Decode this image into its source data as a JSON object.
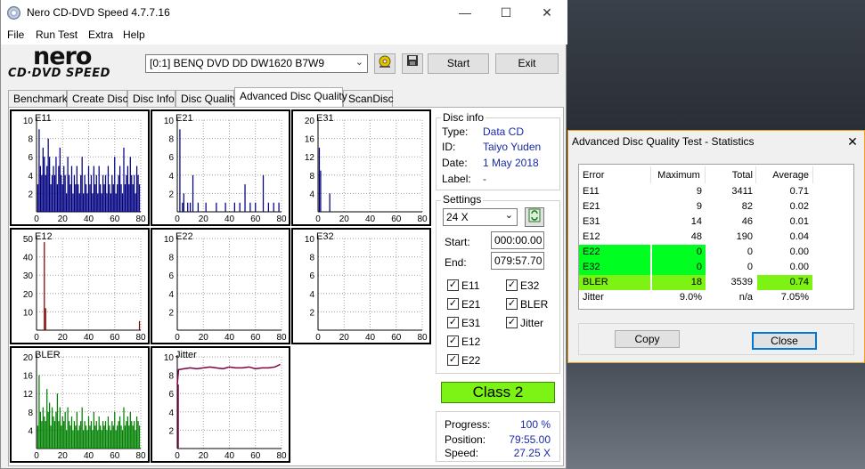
{
  "window": {
    "title": "Nero CD-DVD Speed 4.7.7.16",
    "minimize_glyph": "—",
    "maximize_glyph": "☐",
    "close_glyph": "✕"
  },
  "menu": [
    "File",
    "Run Test",
    "Extra",
    "Help"
  ],
  "logo": {
    "line1": "nero",
    "line2": "CD·DVD SPEED"
  },
  "toolbar": {
    "drive": "[0:1]   BENQ DVD DD DW1620 B7W9",
    "start": "Start",
    "exit": "Exit",
    "icons": [
      "eject-icon",
      "save-icon"
    ]
  },
  "tabs": [
    "Benchmark",
    "Create Disc",
    "Disc Info",
    "Disc Quality",
    "Advanced Disc Quality",
    "ScanDisc"
  ],
  "active_tab": "Advanced Disc Quality",
  "chart_data": [
    {
      "type": "bar",
      "title": "E11",
      "ylim": [
        0,
        10
      ],
      "yticks": [
        2,
        4,
        6,
        8,
        10
      ],
      "xticks": [
        0,
        20,
        40,
        60,
        80
      ],
      "color": "#000080",
      "x": [
        1,
        2,
        3,
        4,
        5,
        6,
        7,
        8,
        9,
        10,
        11,
        12,
        13,
        14,
        15,
        16,
        17,
        18,
        19,
        20,
        21,
        22,
        23,
        24,
        25,
        26,
        27,
        28,
        29,
        30,
        31,
        32,
        33,
        34,
        35,
        36,
        37,
        38,
        39,
        40,
        41,
        42,
        43,
        44,
        45,
        46,
        47,
        48,
        49,
        50,
        51,
        52,
        53,
        54,
        55,
        56,
        57,
        58,
        59,
        60,
        61,
        62,
        63,
        64,
        65,
        66,
        67,
        68,
        69,
        70,
        71,
        72,
        73,
        74,
        75,
        76,
        77,
        78,
        79
      ],
      "values": [
        3,
        9,
        5,
        4,
        7,
        6,
        4,
        5,
        8,
        6,
        3,
        4,
        5,
        4,
        6,
        3,
        5,
        7,
        4,
        3,
        5,
        4,
        2,
        6,
        4,
        3,
        5,
        2,
        4,
        3,
        5,
        3,
        2,
        4,
        6,
        2,
        4,
        3,
        2,
        5,
        3,
        4,
        2,
        5,
        3,
        4,
        2,
        5,
        3,
        2,
        4,
        3,
        4,
        2,
        5,
        3,
        2,
        4,
        3,
        6,
        2,
        3,
        4,
        5,
        3,
        2,
        7,
        3,
        4,
        5,
        3,
        6,
        4,
        3,
        4,
        2,
        5,
        4,
        3
      ]
    },
    {
      "type": "bar",
      "title": "E21",
      "ylim": [
        0,
        10
      ],
      "yticks": [
        2,
        4,
        6,
        8,
        10
      ],
      "xticks": [
        0,
        20,
        40,
        60,
        80
      ],
      "color": "#000080",
      "x": [
        2,
        4,
        5,
        8,
        10,
        12,
        16,
        22,
        30,
        37,
        44,
        48,
        52,
        56,
        60,
        66,
        70,
        74,
        78
      ],
      "values": [
        9,
        1,
        2,
        1,
        1,
        4,
        1,
        1,
        1,
        1,
        1,
        1,
        3,
        1,
        1,
        4,
        1,
        1,
        1
      ]
    },
    {
      "type": "bar",
      "title": "E31",
      "ylim": [
        0,
        20
      ],
      "yticks": [
        4,
        8,
        12,
        16,
        20
      ],
      "xticks": [
        0,
        20,
        40,
        60,
        80
      ],
      "color": "#000080",
      "x": [
        1,
        2,
        9
      ],
      "values": [
        14,
        9,
        4
      ]
    },
    {
      "type": "bar",
      "title": "E12",
      "ylim": [
        0,
        50
      ],
      "yticks": [
        10,
        20,
        30,
        40,
        50
      ],
      "xticks": [
        0,
        20,
        40,
        60,
        80
      ],
      "color": "#800000",
      "x": [
        6,
        7,
        79
      ],
      "values": [
        48,
        12,
        5
      ]
    },
    {
      "type": "bar",
      "title": "E22",
      "ylim": [
        0,
        10
      ],
      "yticks": [
        2,
        4,
        6,
        8,
        10
      ],
      "xticks": [
        0,
        20,
        40,
        60,
        80
      ],
      "color": "#000080",
      "x": [],
      "values": []
    },
    {
      "type": "bar",
      "title": "E32",
      "ylim": [
        0,
        10
      ],
      "yticks": [
        2,
        4,
        6,
        8,
        10
      ],
      "xticks": [
        0,
        20,
        40,
        60,
        80
      ],
      "color": "#000080",
      "x": [],
      "values": []
    },
    {
      "type": "bar",
      "title": "BLER",
      "ylim": [
        0,
        20
      ],
      "yticks": [
        4,
        8,
        12,
        16,
        20
      ],
      "xticks": [
        0,
        20,
        40,
        60,
        80
      ],
      "color": "#008000",
      "x": [
        1,
        2,
        3,
        4,
        5,
        6,
        7,
        8,
        9,
        10,
        11,
        12,
        13,
        14,
        15,
        16,
        17,
        18,
        19,
        20,
        21,
        22,
        23,
        24,
        25,
        26,
        27,
        28,
        29,
        30,
        31,
        32,
        33,
        34,
        35,
        36,
        37,
        38,
        39,
        40,
        41,
        42,
        43,
        44,
        45,
        46,
        47,
        48,
        49,
        50,
        51,
        52,
        53,
        54,
        55,
        56,
        57,
        58,
        59,
        60,
        61,
        62,
        63,
        64,
        65,
        66,
        67,
        68,
        69,
        70,
        71,
        72,
        73,
        74,
        75,
        76,
        77,
        78,
        79
      ],
      "values": [
        5,
        16,
        8,
        6,
        9,
        7,
        6,
        13,
        8,
        10,
        5,
        9,
        7,
        6,
        8,
        12,
        6,
        9,
        5,
        7,
        6,
        8,
        4,
        9,
        6,
        5,
        7,
        4,
        6,
        5,
        8,
        4,
        5,
        6,
        9,
        4,
        6,
        5,
        4,
        7,
        5,
        6,
        4,
        8,
        5,
        6,
        4,
        7,
        5,
        4,
        6,
        5,
        6,
        4,
        7,
        5,
        4,
        6,
        5,
        8,
        4,
        5,
        6,
        7,
        5,
        4,
        9,
        5,
        6,
        7,
        5,
        8,
        6,
        5,
        6,
        4,
        7,
        6,
        5
      ]
    },
    {
      "type": "line",
      "title": "Jitter",
      "ylim": [
        0,
        10
      ],
      "yticks": [
        2,
        4,
        6,
        8,
        10
      ],
      "xticks": [
        0,
        20,
        40,
        60,
        80
      ],
      "color": "#800040",
      "x": [
        0,
        1,
        5,
        10,
        15,
        20,
        25,
        30,
        35,
        40,
        45,
        50,
        55,
        60,
        65,
        70,
        75,
        78,
        79
      ],
      "values": [
        7.0,
        8.6,
        8.7,
        8.8,
        8.7,
        8.8,
        8.9,
        8.8,
        8.7,
        8.9,
        8.8,
        8.8,
        8.9,
        8.7,
        8.8,
        8.8,
        8.9,
        9.1,
        9.2
      ]
    }
  ],
  "disc_info": {
    "heading": "Disc info",
    "rows": [
      {
        "label": "Type:",
        "value": "Data CD"
      },
      {
        "label": "ID:",
        "value": "Taiyo Yuden"
      },
      {
        "label": "Date:",
        "value": "1 May 2018"
      },
      {
        "label": "Label:",
        "value": "-"
      }
    ]
  },
  "settings": {
    "heading": "Settings",
    "speed": "24 X",
    "start_label": "Start:",
    "start": "000:00.00",
    "end_label": "End:",
    "end": "079:57.70",
    "checks": [
      {
        "label": "E11",
        "checked": true
      },
      {
        "label": "E32",
        "checked": true
      },
      {
        "label": "E21",
        "checked": true
      },
      {
        "label": "BLER",
        "checked": true
      },
      {
        "label": "E31",
        "checked": true
      },
      {
        "label": "Jitter",
        "checked": true
      },
      {
        "label": "E12",
        "checked": true
      },
      {
        "label": "E22",
        "checked": true
      }
    ]
  },
  "class": "Class 2",
  "progress": {
    "rows": [
      {
        "label": "Progress:",
        "value": "100 %"
      },
      {
        "label": "Position:",
        "value": "79:55.00"
      },
      {
        "label": "Speed:",
        "value": "27.25 X"
      }
    ]
  },
  "stats": {
    "title": "Advanced Disc Quality Test - Statistics",
    "close_glyph": "✕",
    "headers": [
      "Error",
      "Maximum",
      "Total",
      "Average"
    ],
    "rows": [
      {
        "cells": [
          "E11",
          "9",
          "3411",
          "0.71"
        ],
        "hl": []
      },
      {
        "cells": [
          "E21",
          "9",
          "82",
          "0.02"
        ],
        "hl": []
      },
      {
        "cells": [
          "E31",
          "14",
          "46",
          "0.01"
        ],
        "hl": []
      },
      {
        "cells": [
          "E12",
          "48",
          "190",
          "0.04"
        ],
        "hl": []
      },
      {
        "cells": [
          "E22",
          "0",
          "0",
          "0.00"
        ],
        "hl": [
          0,
          1
        ]
      },
      {
        "cells": [
          "E32",
          "0",
          "0",
          "0.00"
        ],
        "hl": [
          0,
          1
        ]
      },
      {
        "cells": [
          "BLER",
          "18",
          "3539",
          "0.74"
        ],
        "hl": [
          0,
          1,
          3
        ]
      },
      {
        "cells": [
          "Jitter",
          "9.0%",
          "n/a",
          "7.05%"
        ],
        "hl": []
      }
    ],
    "highlight_color": "#00ff21",
    "highlight_color_bler": "#7cf215",
    "copy": "Copy",
    "close": "Close"
  }
}
